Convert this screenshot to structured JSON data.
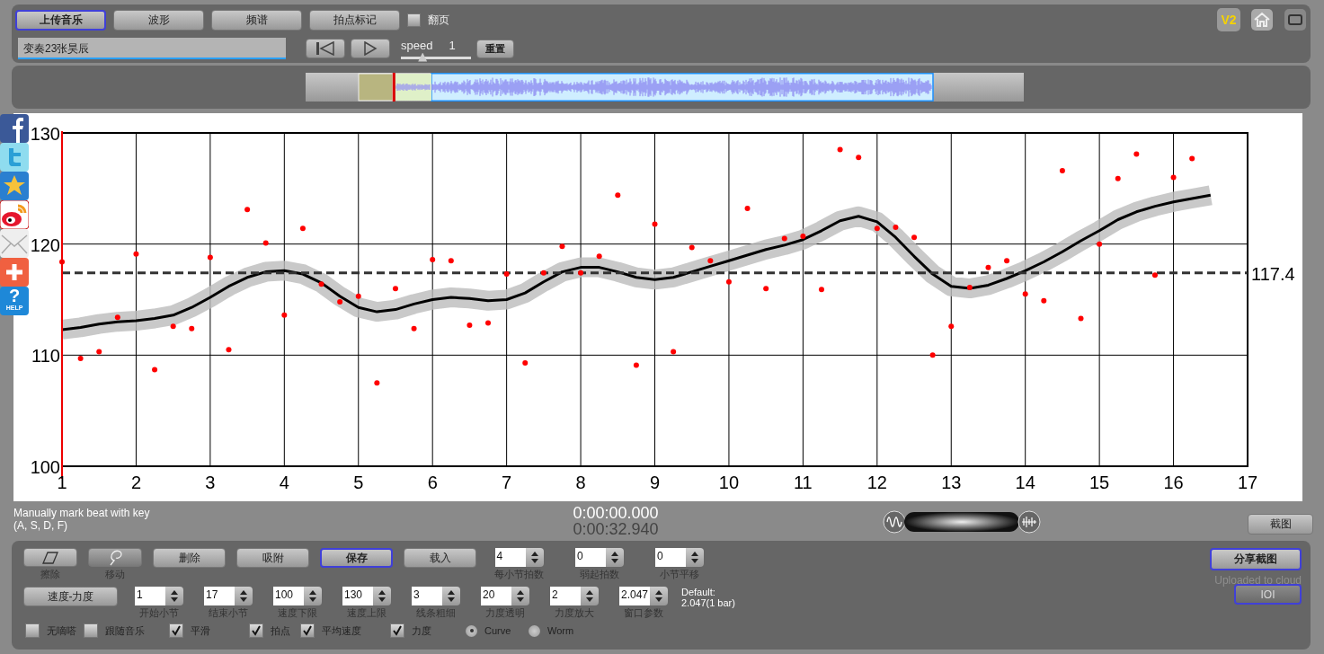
{
  "top_tabs": [
    {
      "label": "上传音乐",
      "selected": true
    },
    {
      "label": "波形",
      "selected": false
    },
    {
      "label": "频谱",
      "selected": false
    },
    {
      "label": "拍点标记",
      "selected": false
    }
  ],
  "page_flip": {
    "label": "翻页",
    "checked": false
  },
  "file_field": {
    "value": "变奏23张昊辰"
  },
  "speed": {
    "label": "speed",
    "value": "1",
    "level": 0.31
  },
  "reset_button": "重置",
  "version_badge": "V2",
  "overview": {
    "playhead": {
      "level": 0.123
    }
  },
  "social_help": {
    "mark": "?",
    "label": "HELP"
  },
  "chart_data": {
    "type": "scatter",
    "xlim": [
      1,
      17
    ],
    "ylim": [
      100,
      130
    ],
    "xticks": [
      1,
      2,
      3,
      4,
      5,
      6,
      7,
      8,
      9,
      10,
      11,
      12,
      13,
      14,
      15,
      16,
      17
    ],
    "yticks": [
      100,
      110,
      120,
      130
    ],
    "x": [
      1,
      1.25,
      1.5,
      1.75,
      2,
      2.25,
      2.5,
      2.75,
      3,
      3.25,
      3.5,
      3.75,
      4,
      4.25,
      4.5,
      4.75,
      5,
      5.25,
      5.5,
      5.75,
      6,
      6.25,
      6.5,
      6.75,
      7,
      7.25,
      7.5,
      7.75,
      8,
      8.25,
      8.5,
      8.75,
      9,
      9.25,
      9.5,
      9.75,
      10,
      10.25,
      10.5,
      10.75,
      11,
      11.25,
      11.5,
      11.75,
      12,
      12.25,
      12.5,
      12.75,
      13,
      13.25,
      13.5,
      13.75,
      14,
      14.25,
      14.5,
      14.75,
      15,
      15.25,
      15.5,
      15.75,
      16,
      16.25,
      16.5
    ],
    "series": [
      {
        "color": "#ff0000",
        "values": [
          118.4,
          109.7,
          110.3,
          113.4,
          119.1,
          108.7,
          112.6,
          112.4,
          118.8,
          110.5,
          123.1,
          120.1,
          113.6,
          121.4,
          116.4,
          114.8,
          115.3,
          107.5,
          116.0,
          112.4,
          118.6,
          118.5,
          112.7,
          112.9,
          117.3,
          109.3,
          117.4,
          119.8,
          117.4,
          118.9,
          124.4,
          109.1,
          121.8,
          110.3,
          119.7,
          118.5,
          116.6,
          123.2,
          116.0,
          120.5,
          120.7,
          115.9,
          128.5,
          127.8,
          121.4,
          121.5,
          120.6,
          110.0,
          112.6,
          116.1,
          117.9,
          118.5,
          115.5,
          114.9,
          126.6,
          113.3,
          120.0,
          125.9,
          128.1,
          117.2,
          126.0,
          127.7,
          null
        ]
      },
      {
        "type": "line",
        "color": "#000000",
        "values": [
          112.3,
          112.5,
          112.8,
          113.0,
          113.1,
          113.3,
          113.6,
          114.3,
          115.2,
          116.2,
          117.0,
          117.5,
          117.6,
          117.3,
          116.5,
          115.3,
          114.3,
          113.9,
          114.1,
          114.6,
          115.0,
          115.2,
          115.1,
          114.9,
          115.0,
          115.6,
          116.6,
          117.5,
          117.9,
          117.9,
          117.5,
          117.0,
          116.8,
          117.0,
          117.5,
          118.0,
          118.5,
          119.0,
          119.5,
          119.9,
          120.4,
          121.2,
          122.1,
          122.5,
          122.0,
          120.6,
          118.9,
          117.3,
          116.2,
          116.0,
          116.3,
          116.9,
          117.6,
          118.4,
          119.3,
          120.3,
          121.2,
          122.2,
          122.9,
          123.4,
          123.8,
          124.1,
          124.4
        ]
      }
    ],
    "grid": true,
    "ref_lines": [
      {
        "axis": "y",
        "value": 117.4,
        "label": "117.4"
      }
    ]
  },
  "hint": [
    "Manually mark beat with key",
    "(A, S, D, F)"
  ],
  "time_current": "0:00:00.000",
  "time_total": "0:00:32.940",
  "screenshot_button": "截图",
  "tool_buttons": [
    {
      "kind": "eraser",
      "label": "擦除",
      "selected": false
    },
    {
      "kind": "hand",
      "label": "移动",
      "selected": true
    },
    {
      "kind": "text",
      "label": "删除",
      "selected": false
    },
    {
      "kind": "text",
      "label": "吸附",
      "selected": false
    },
    {
      "kind": "text",
      "label": "保存",
      "selected": true
    },
    {
      "kind": "text",
      "label": "载入",
      "selected": false
    }
  ],
  "spinners_row1": [
    {
      "value": "4",
      "label": "每小节拍数"
    },
    {
      "value": "0",
      "label": "弱起拍数"
    },
    {
      "value": "0",
      "label": "小节平移"
    }
  ],
  "mode_button": "速度-力度",
  "spinners_row2": [
    {
      "value": "1",
      "label": "开始小节"
    },
    {
      "value": "17",
      "label": "结束小节"
    },
    {
      "value": "100",
      "label": "速度下限"
    },
    {
      "value": "130",
      "label": "速度上限"
    },
    {
      "value": "3",
      "label": "线条粗细"
    },
    {
      "value": "20",
      "label": "力度透明"
    },
    {
      "value": "2",
      "label": "力度放大"
    },
    {
      "value": "2.047",
      "label": "窗口参数"
    }
  ],
  "default_note": [
    "Default:",
    "2.047(1 bar)"
  ],
  "options": [
    {
      "kind": "checkbox",
      "label": "无嘀嗒",
      "checked": false
    },
    {
      "kind": "checkbox",
      "label": "跟随音乐",
      "checked": false
    },
    {
      "kind": "checkbox",
      "label": "平滑",
      "checked": true
    },
    {
      "kind": "checkbox",
      "label": "拍点",
      "checked": true
    },
    {
      "kind": "checkbox",
      "label": "平均速度",
      "checked": true
    },
    {
      "kind": "checkbox",
      "label": "力度",
      "checked": true
    },
    {
      "kind": "radio",
      "label": "Curve",
      "selected": true
    },
    {
      "kind": "radio",
      "label": "Worm",
      "selected": false
    }
  ],
  "share_button": "分享截图",
  "upload_status": "Uploaded to cloud",
  "ioi_button": {
    "label": "IOI",
    "disabled": true
  }
}
